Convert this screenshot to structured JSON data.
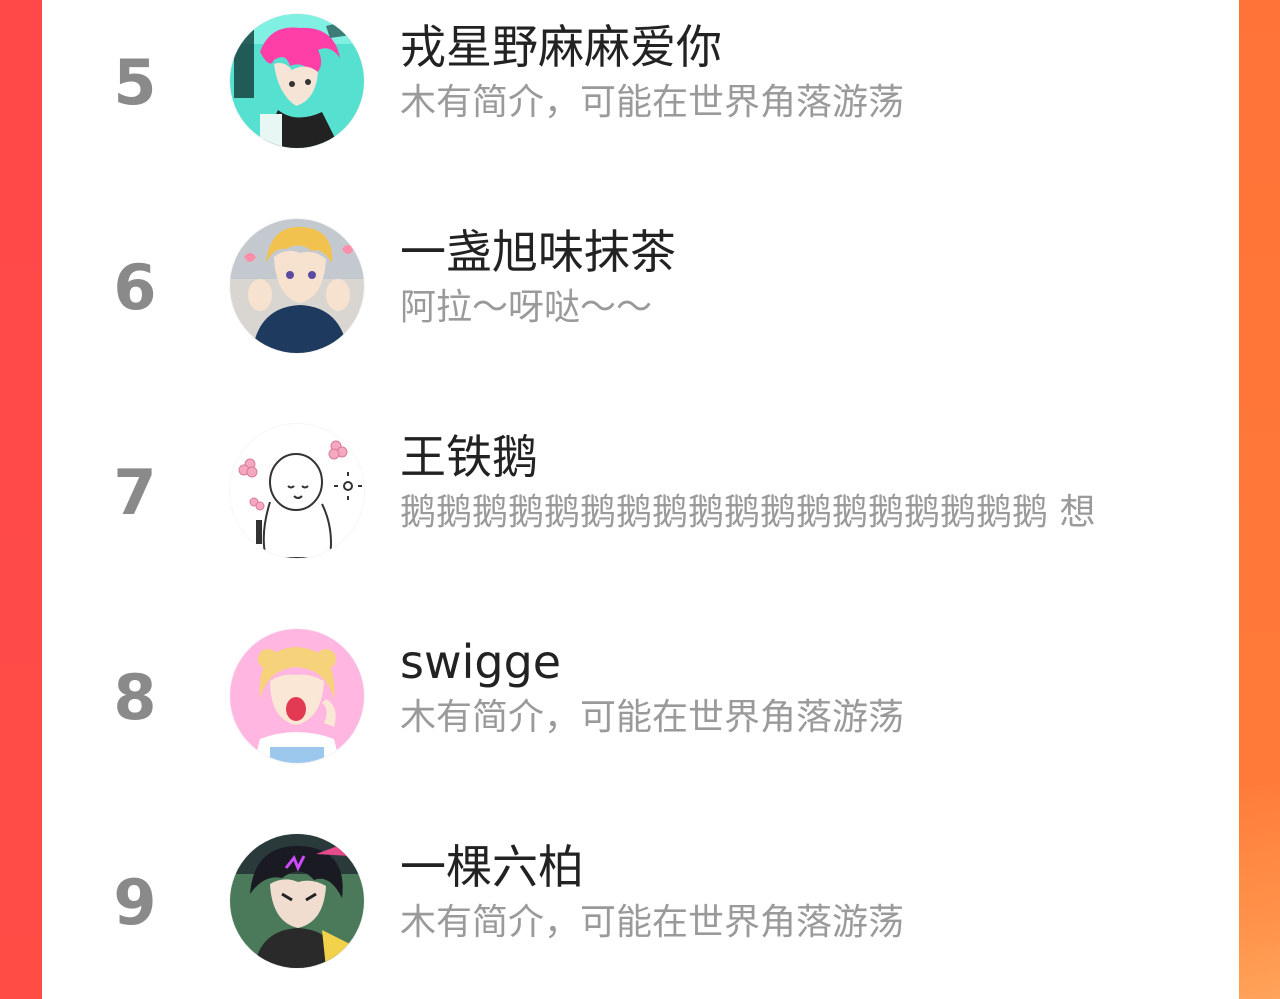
{
  "theme": {
    "accent_left": "#ff4848",
    "accent_right": "#ff7a39",
    "rank_color": "#8a8a8a",
    "name_color": "#222222",
    "bio_color": "#9a9a9a"
  },
  "ranking": [
    {
      "rank": "5",
      "name": "戎星野麻麻爱你",
      "bio": "木有简介，可能在世界角落游荡",
      "avatar_icon": "anime-pink-hair-avatar"
    },
    {
      "rank": "6",
      "name": "一盏旭味抹茶",
      "bio": "阿拉～呀哒～～",
      "avatar_icon": "anime-blonde-boy-avatar"
    },
    {
      "rank": "7",
      "name": "王铁鹅",
      "bio": "鹅鹅鹅鹅鹅鹅鹅鹅鹅鹅鹅鹅鹅鹅鹅鹅鹅鹅 想",
      "avatar_icon": "sketch-doodle-avatar"
    },
    {
      "rank": "8",
      "name": "swigge",
      "bio": "木有简介，可能在世界角落游荡",
      "avatar_icon": "sailor-moon-avatar"
    },
    {
      "rank": "9",
      "name": "一棵六柏",
      "bio": "木有简介，可能在世界角落游荡",
      "avatar_icon": "anime-dark-hair-avatar"
    }
  ]
}
